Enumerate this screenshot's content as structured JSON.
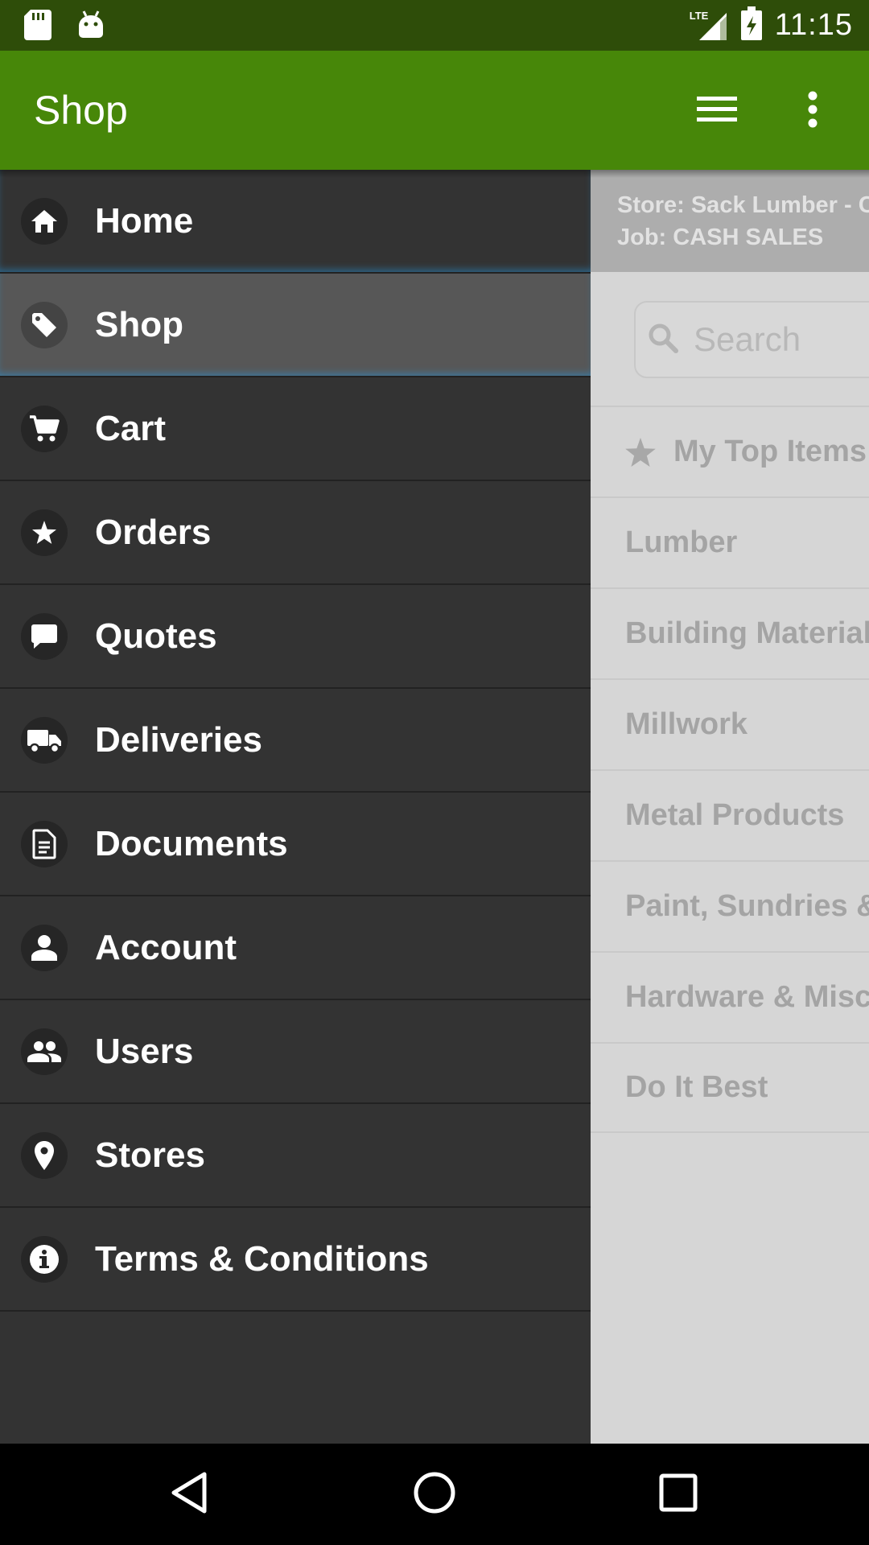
{
  "status_bar": {
    "time": "11:15",
    "network": "LTE"
  },
  "app_bar": {
    "title": "Shop"
  },
  "drawer": {
    "items": [
      {
        "label": "Home",
        "icon": "home-icon"
      },
      {
        "label": "Shop",
        "icon": "tag-icon"
      },
      {
        "label": "Cart",
        "icon": "cart-icon"
      },
      {
        "label": "Orders",
        "icon": "star-icon"
      },
      {
        "label": "Quotes",
        "icon": "chat-bubble-icon"
      },
      {
        "label": "Deliveries",
        "icon": "truck-icon"
      },
      {
        "label": "Documents",
        "icon": "document-icon"
      },
      {
        "label": "Account",
        "icon": "person-icon"
      },
      {
        "label": "Users",
        "icon": "group-icon"
      },
      {
        "label": "Stores",
        "icon": "location-pin-icon"
      },
      {
        "label": "Terms & Conditions",
        "icon": "info-icon"
      }
    ],
    "selected": "Shop"
  },
  "main": {
    "store_line": "Store: Sack Lumber - C",
    "job_line": "Job: CASH SALES",
    "search_placeholder": "Search",
    "categories": [
      "My Top Items",
      "Lumber",
      "Building Materials",
      "Millwork",
      "Metal Products",
      "Paint, Sundries &",
      "Hardware & Misc",
      "Do It Best"
    ]
  },
  "colors": {
    "status_bar": "#2e4d09",
    "app_bar": "#478709",
    "drawer": "#333333",
    "drawer_active": "#575757"
  }
}
